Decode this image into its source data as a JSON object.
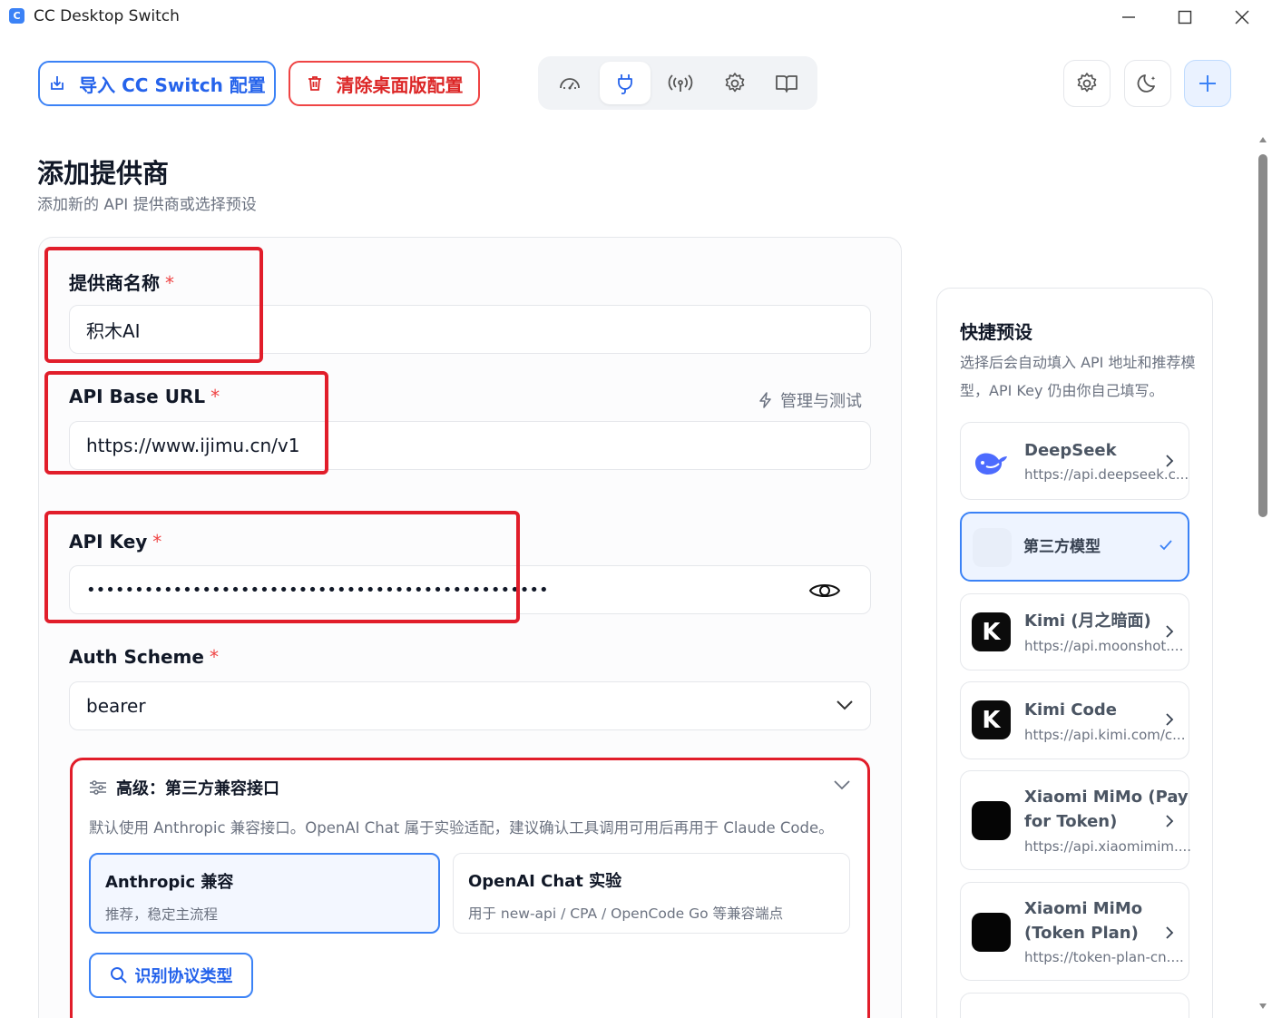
{
  "window": {
    "title": "CC Desktop Switch",
    "app_icon_glyph": "C"
  },
  "toolbar": {
    "import_label": "导入 CC Switch 配置",
    "clear_label": "清除桌面版配置",
    "nav_icons": [
      "gauge-icon",
      "plug-icon",
      "broadcast-icon",
      "gear-icon",
      "book-icon"
    ],
    "active_nav": "plug-icon"
  },
  "page": {
    "title": "添加提供商",
    "subtitle": "添加新的 API 提供商或选择预设"
  },
  "form": {
    "required_mark": "*",
    "provider_name": {
      "label": "提供商名称",
      "value": "积木AI"
    },
    "base_url": {
      "label": "API Base URL",
      "value": "https://www.ijimu.cn/v1",
      "manage_label": "管理与测试"
    },
    "api_key": {
      "label": "API Key",
      "value": "••••••••••••••••••••••••••••••••••••••••••••••••"
    },
    "auth_scheme": {
      "label": "Auth Scheme",
      "value": "bearer"
    },
    "advanced": {
      "title": "高级：第三方兼容接口",
      "description": "默认使用 Anthropic 兼容接口。OpenAI Chat 属于实验适配，建议确认工具调用可用后再用于 Claude Code。",
      "options": [
        {
          "title": "Anthropic 兼容",
          "desc": "推荐，稳定主流程"
        },
        {
          "title": "OpenAI Chat 实验",
          "desc": "用于 new-api / CPA / OpenCode Go 等兼容端点"
        }
      ],
      "detect_label": "识别协议类型"
    }
  },
  "presets": {
    "title": "快捷预设",
    "description": "选择后会自动填入 API 地址和推荐模型，API Key 仍由你自己填写。",
    "items": [
      {
        "name": "DeepSeek",
        "url": "https://api.deepseek.c..."
      },
      {
        "name": "第三方模型"
      },
      {
        "name": "Kimi (月之暗面)",
        "url": "https://api.moonshot...."
      },
      {
        "name": "Kimi Code",
        "url": "https://api.kimi.com/c..."
      },
      {
        "name_line1": "Xiaomi MiMo (Pay",
        "name_line2": "for Token)",
        "url": "https://api.xiaomimim...."
      },
      {
        "name_line1": "Xiaomi MiMo",
        "name_line2": "(Token Plan)",
        "url": "https://token-plan-cn...."
      }
    ],
    "kimi_logo_glyph": "K"
  },
  "colors": {
    "accent": "#3b82f6",
    "danger": "#ef4444",
    "highlight_annotation": "#e11d2a"
  }
}
